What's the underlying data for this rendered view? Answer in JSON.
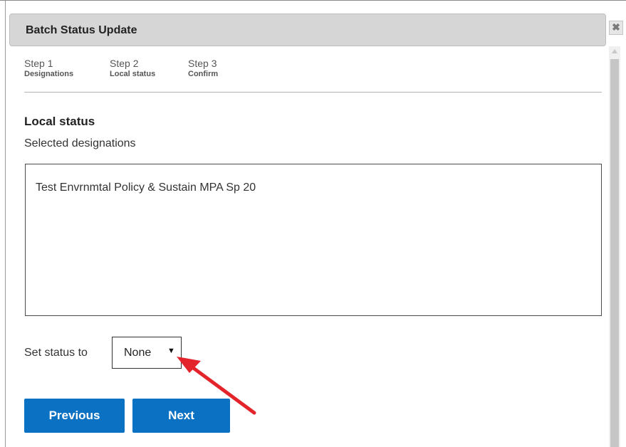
{
  "dialog": {
    "title": "Batch Status Update",
    "close_icon": "close-icon",
    "close_glyph": "✖"
  },
  "steps": [
    {
      "number": "Step 1",
      "name": "Designations"
    },
    {
      "number": "Step 2",
      "name": "Local status"
    },
    {
      "number": "Step 3",
      "name": "Confirm"
    }
  ],
  "section": {
    "title": "Local status",
    "subtitle": "Selected designations"
  },
  "designations": [
    "Test Envrnmtal Policy & Sustain MPA Sp 20"
  ],
  "status": {
    "label": "Set status to",
    "selected": "None",
    "arrow_glyph": "▼"
  },
  "buttons": {
    "previous": "Previous",
    "next": "Next"
  },
  "colors": {
    "primary_button": "#0b71c3",
    "annotation_arrow": "#e3242b",
    "titlebar": "#d6d6d6"
  }
}
